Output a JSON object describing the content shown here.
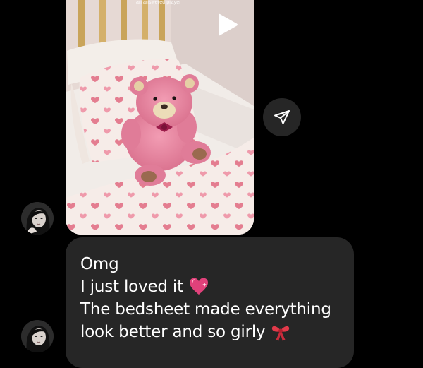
{
  "video": {
    "caption": "an answered prayer"
  },
  "message": {
    "lines": [
      "Omg",
      "I just loved it",
      "The bedsheet made everything",
      "look better and so girly"
    ],
    "emojis": {
      "line2": "sparkling-heart",
      "line4": "ribbon"
    }
  },
  "icons": {
    "play": "play-icon",
    "share": "send-icon"
  },
  "colors": {
    "background": "#000000",
    "bubble": "#262626",
    "share_button": "#262626",
    "text": "#ffffff",
    "teddy": "#e8869f",
    "heart_pattern": "#e47d90"
  }
}
